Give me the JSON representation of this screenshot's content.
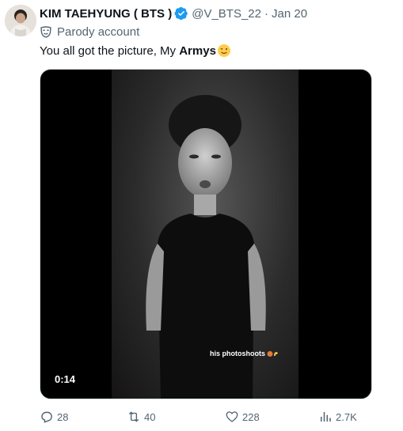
{
  "tweet": {
    "display_name": "KIM TAEHYUNG ( BTS )",
    "handle": "@V_BTS_22",
    "separator": "·",
    "date": "Jan 20",
    "parody_label": "Parody account",
    "text_prefix": "You all got the picture, My ",
    "text_bold": "Armys",
    "verified_color": "#1d9bf0"
  },
  "media": {
    "caption": "his photoshoots",
    "duration": "0:14"
  },
  "actions": {
    "replies": "28",
    "reposts": "40",
    "likes": "228",
    "views": "2.7K"
  }
}
